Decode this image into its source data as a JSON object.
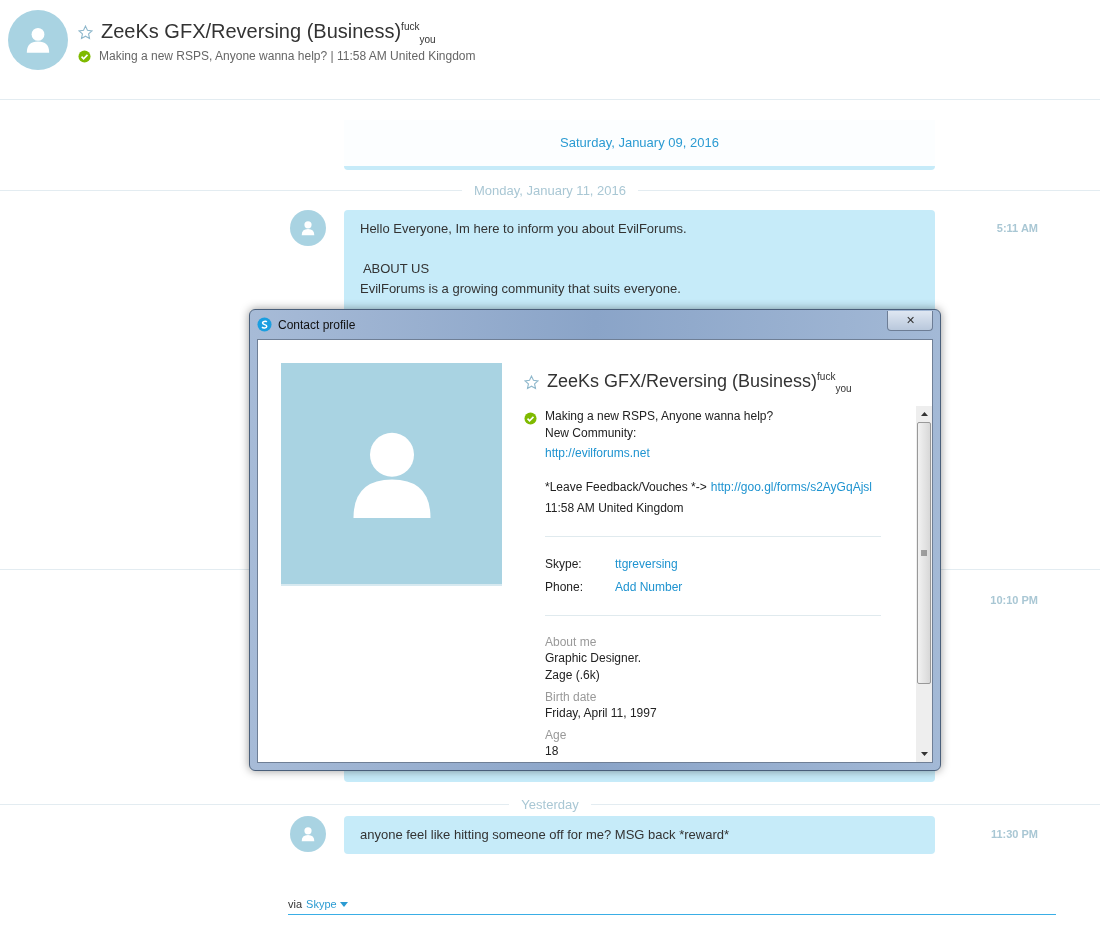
{
  "header": {
    "name": "ZeeKs GFX/Reversing (Business)$^{fuck}$$_{you}$",
    "favorite": false,
    "online": true,
    "mood": "Making a new RSPS, Anyone wanna help?",
    "separator": "|",
    "local_time": "11:58 AM United Kingdom"
  },
  "sticky_date": "Saturday, January 09, 2016",
  "conversation": [
    {
      "kind": "divider",
      "label": "Monday, January 11, 2016"
    },
    {
      "kind": "message",
      "paragraphs": [
        [
          "Hello Everyone, Im here to inform you about EvilForums."
        ],
        [
          " ABOUT US",
          "EvilForums is a growing community that suits everyone."
        ]
      ],
      "time": "5:11 AM"
    },
    {
      "kind": "divider"
    },
    {
      "kind": "message",
      "time": "10:10 PM"
    },
    {
      "kind": "divider",
      "label": "Yesterday"
    },
    {
      "kind": "message",
      "paragraphs": [
        [
          "anyone feel like hitting someone off for me? MSG back *reward*"
        ]
      ],
      "time": "11:30 PM"
    }
  ],
  "footer": {
    "prefix": "via",
    "service": "Skype"
  },
  "dialog": {
    "title": "Contact profile",
    "close": "✕",
    "name": "ZeeKs GFX/Reversing (Business)$^{fuck}$$_{you}$",
    "favorite": false,
    "online": true,
    "mood_lines": [
      {
        "text": "Making a new RSPS, Anyone wanna help?"
      },
      {
        "text": "New Community:"
      },
      {
        "link": "http://evilforums.net"
      }
    ],
    "feedback": {
      "text": "*Leave Feedback/Vouches *->",
      "link": "http://goo.gl/forms/s2AyGqAjsl"
    },
    "local_time": "11:58 AM United Kingdom",
    "contacts": [
      {
        "label": "Skype:",
        "value": "ttgreversing"
      },
      {
        "label": "Phone:",
        "value": "Add Number"
      }
    ],
    "details": [
      {
        "label": "About me",
        "values": [
          "Graphic Designer.",
          "Zage (.6k)"
        ]
      },
      {
        "label": "Birth date",
        "values": [
          "Friday, April 11, 1997"
        ]
      },
      {
        "label": "Age",
        "values": [
          "18"
        ]
      }
    ]
  }
}
